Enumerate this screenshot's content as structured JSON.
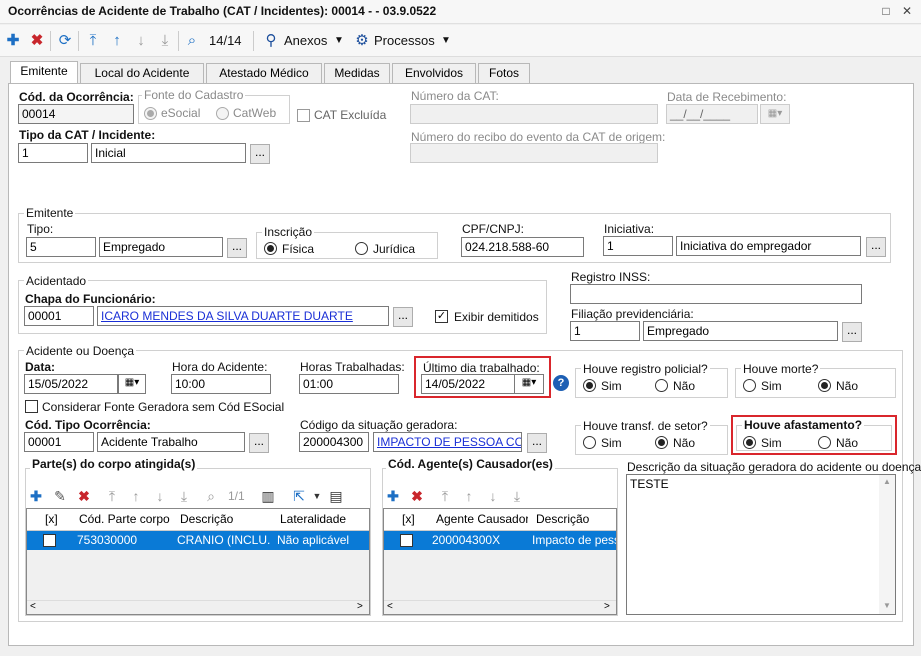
{
  "window": {
    "title": "Ocorrências de Acidente de Trabalho (CAT / Incidentes): 00014 -  - 03.9.0522"
  },
  "toolbar": {
    "record_counter": "14/14",
    "attachments_label": "Anexos",
    "processes_label": "Processos"
  },
  "tabs": [
    "Emitente",
    "Local do Acidente",
    "Atestado Médico",
    "Medidas",
    "Envolvidos",
    "Fotos"
  ],
  "occurrence": {
    "code_label": "Cód. da Ocorrência:",
    "code_value": "00014",
    "source_label": "Fonte do Cadastro",
    "source_options": [
      "eSocial",
      "CatWeb"
    ],
    "cat_excluded_label": "CAT Excluída",
    "cat_number_label": "Número da CAT:",
    "receipt_date_label": "Data de Recebimento:",
    "receipt_date_value": "__/__/____",
    "type_label": "Tipo da CAT / Incidente:",
    "type_code": "1",
    "type_desc": "Inicial",
    "origin_receipt_label": "Número do recibo do evento da CAT de origem:"
  },
  "emitente": {
    "title": "Emitente",
    "tipo_label": "Tipo:",
    "tipo_code": "5",
    "tipo_desc": "Empregado",
    "inscricao_label": "Inscrição",
    "inscricao_options": [
      "Física",
      "Jurídica"
    ],
    "cpf_label": "CPF/CNPJ:",
    "cpf_value": "024.218.588-60",
    "iniciativa_label": "Iniciativa:",
    "iniciativa_code": "1",
    "iniciativa_desc": "Iniciativa do empregador"
  },
  "acidentado": {
    "title": "Acidentado",
    "chapa_label": "Chapa do Funcionário:",
    "chapa_value": "00001",
    "name": "ICARO MENDES DA SILVA DUARTE DUARTE",
    "show_dismissed_label": "Exibir demitidos",
    "inss_label": "Registro INSS:",
    "filiacao_label": "Filiação previdenciária:",
    "filiacao_code": "1",
    "filiacao_desc": "Empregado"
  },
  "acidente": {
    "title": "Acidente ou Doença",
    "data_label": "Data:",
    "data_value": "15/05/2022",
    "hora_label": "Hora do Acidente:",
    "hora_value": "10:00",
    "horas_trab_label": "Horas Trabalhadas:",
    "horas_trab_value": "01:00",
    "ultimo_dia_label": "Último dia trabalhado:",
    "ultimo_dia_value": "14/05/2022",
    "fonte_geradora_label": "Considerar Fonte Geradora sem Cód ESocial",
    "tipo_ocorrencia_label": "Cód. Tipo Ocorrência:",
    "tipo_ocorrencia_code": "00001",
    "tipo_ocorrencia_desc": "Acidente Trabalho",
    "situacao_label": "Código da situação geradora:",
    "situacao_code": "200004300",
    "situacao_desc": "IMPACTO DE PESSOA CONT",
    "registro_policial_label": "Houve registro policial?",
    "morte_label": "Houve morte?",
    "transf_setor_label": "Houve transf. de setor?",
    "afastamento_label": "Houve afastamento?",
    "sim": "Sim",
    "nao": "Não",
    "descricao_label": "Descrição da situação geradora do acidente ou doença:",
    "descricao_value": "TESTE"
  },
  "partes": {
    "title": "Parte(s) do corpo atingida(s)",
    "pager": "1/1",
    "columns": [
      "[x]",
      "Cód. Parte corpo",
      "Descrição",
      "Lateralidade"
    ],
    "rows": [
      {
        "code": "753030000",
        "desc": "CRANIO (INCLU...",
        "lat": "Não aplicável"
      }
    ]
  },
  "agentes": {
    "title": "Cód. Agente(s) Causador(es)",
    "columns": [
      "[x]",
      "Agente Causador",
      "Descrição"
    ],
    "rows": [
      {
        "code": "200004300X",
        "desc": "Impacto de pess..."
      }
    ]
  },
  "colors": {
    "selection": "#0a7ad6",
    "highlight_border": "#d9262c",
    "link": "#1a2fd6"
  }
}
